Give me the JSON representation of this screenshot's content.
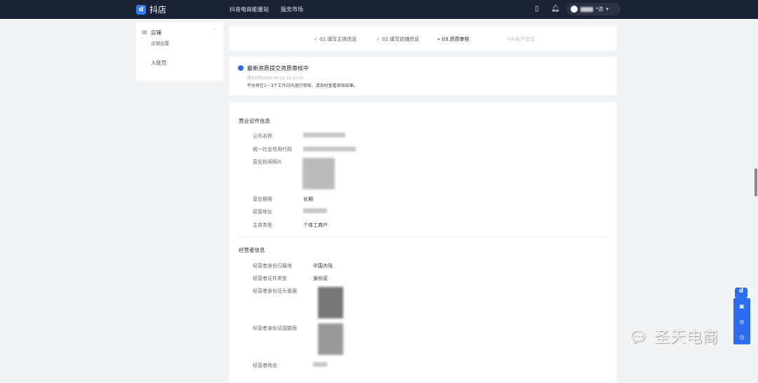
{
  "header": {
    "logo": "抖店",
    "nav": [
      "抖音电商能量站",
      "服务市场"
    ],
    "user_suffix": "*选"
  },
  "sidebar": {
    "group": "店铺",
    "sub": "店铺设置",
    "item": "入驻页"
  },
  "steps": [
    "01.填写主体信息",
    "02.填写店铺信息",
    "03.资质审核",
    "04.账户验证"
  ],
  "notice": {
    "title": "最新资质提交资质审核中",
    "time": "提交时间2021-06-12 11:27:07",
    "desc": "平台将在1－3个工作日内进行审核，请及时查看审核结果。"
  },
  "business": {
    "title": "营业证件信息",
    "rows": [
      {
        "label": "公司名称",
        "value": ""
      },
      {
        "label": "统一社会信用代码",
        "value": ""
      },
      {
        "label": "营业执照照片",
        "value": ""
      },
      {
        "label": "营业期限",
        "value": "长期"
      },
      {
        "label": "经营地址",
        "value": ""
      },
      {
        "label": "主体类型",
        "value": "个体工商户"
      }
    ]
  },
  "operator": {
    "title": "经营者信息",
    "rows": [
      {
        "label": "经营者身份归属地",
        "value": "中国大陆"
      },
      {
        "label": "经营者证件类型",
        "value": "身份证"
      },
      {
        "label": "经营者身份证头像面",
        "value": ""
      },
      {
        "label": "经营者身份证国徽面",
        "value": ""
      },
      {
        "label": "经营者姓名",
        "value": ""
      }
    ]
  },
  "watermark": "圣天电商"
}
